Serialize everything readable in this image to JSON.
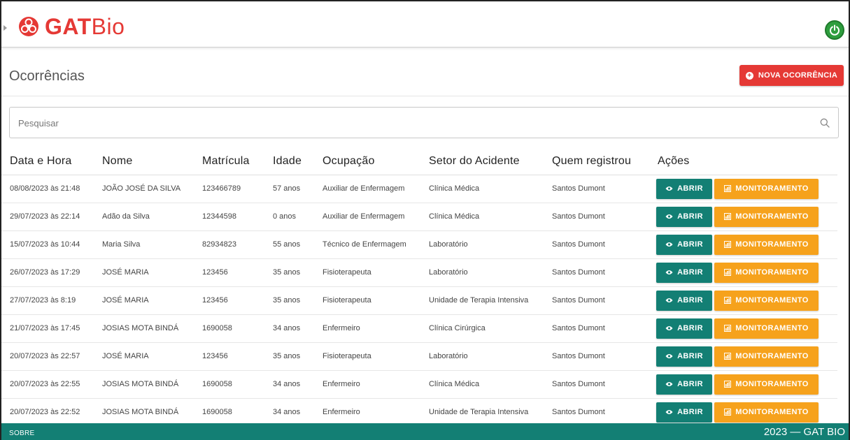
{
  "app": {
    "logo_bold": "GAT",
    "logo_thin": "Bio",
    "accent": "#e53935",
    "primary": "#137f74",
    "warning": "#f6a21c"
  },
  "page": {
    "title": "Ocorrências",
    "new_button": "NOVA OCORRÊNCIA"
  },
  "search": {
    "placeholder": "Pesquisar",
    "value": ""
  },
  "table": {
    "headers": [
      "Data e Hora",
      "Nome",
      "Matrícula",
      "Idade",
      "Ocupação",
      "Setor do Acidente",
      "Quem registrou",
      "Ações"
    ],
    "action_open": "ABRIR",
    "action_monitor": "MONITORAMENTO",
    "rows": [
      {
        "datetime": "08/08/2023 às 21:48",
        "name": "JOÃO JOSÉ DA SILVA",
        "id": "123466789",
        "age": "57 anos",
        "occupation": "Auxiliar de Enfermagem",
        "sector": "Clínica Médica",
        "registered_by": "Santos Dumont"
      },
      {
        "datetime": "29/07/2023 às 22:14",
        "name": "Adão da Silva",
        "id": "12344598",
        "age": "0 anos",
        "occupation": "Auxiliar de Enfermagem",
        "sector": "Clínica Médica",
        "registered_by": "Santos Dumont"
      },
      {
        "datetime": "15/07/2023 às 10:44",
        "name": "Maria Silva",
        "id": "82934823",
        "age": "55 anos",
        "occupation": "Técnico de Enfermagem",
        "sector": "Laboratório",
        "registered_by": "Santos Dumont"
      },
      {
        "datetime": "26/07/2023 às 17:29",
        "name": "JOSÉ MARIA",
        "id": "123456",
        "age": "35 anos",
        "occupation": "Fisioterapeuta",
        "sector": "Laboratório",
        "registered_by": "Santos Dumont"
      },
      {
        "datetime": "27/07/2023 às 8:19",
        "name": "JOSÉ MARIA",
        "id": "123456",
        "age": "35 anos",
        "occupation": "Fisioterapeuta",
        "sector": "Unidade de Terapia Intensiva",
        "registered_by": "Santos Dumont"
      },
      {
        "datetime": "21/07/2023 às 17:45",
        "name": "JOSIAS MOTA BINDÁ",
        "id": "1690058",
        "age": "34 anos",
        "occupation": "Enfermeiro",
        "sector": "Clínica Cirúrgica",
        "registered_by": "Santos Dumont"
      },
      {
        "datetime": "20/07/2023 às 22:57",
        "name": "JOSÉ MARIA",
        "id": "123456",
        "age": "35 anos",
        "occupation": "Fisioterapeuta",
        "sector": "Laboratório",
        "registered_by": "Santos Dumont"
      },
      {
        "datetime": "20/07/2023 às 22:55",
        "name": "JOSIAS MOTA BINDÁ",
        "id": "1690058",
        "age": "34 anos",
        "occupation": "Enfermeiro",
        "sector": "Clínica Médica",
        "registered_by": "Santos Dumont"
      },
      {
        "datetime": "20/07/2023 às 22:52",
        "name": "JOSIAS MOTA BINDÁ",
        "id": "1690058",
        "age": "34 anos",
        "occupation": "Enfermeiro",
        "sector": "Unidade de Terapia Intensiva",
        "registered_by": "Santos Dumont"
      }
    ]
  },
  "footer": {
    "about": "SOBRE",
    "copyright": "2023 — GAT BIO"
  },
  "icons": {
    "logo": "biohazard-icon",
    "power": "power-icon",
    "search": "search-icon",
    "add": "plus-circle-icon",
    "open": "eye-icon",
    "monitor": "chart-icon"
  }
}
